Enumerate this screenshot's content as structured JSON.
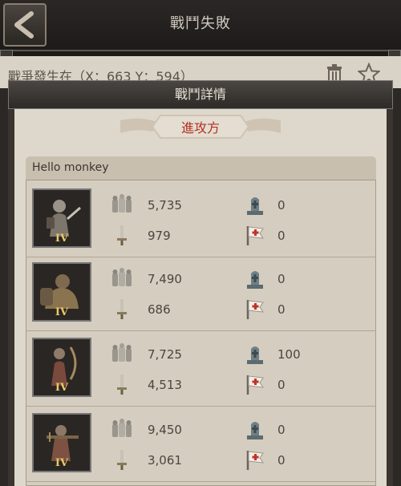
{
  "header": {
    "title": "戰鬥失敗"
  },
  "location": {
    "text": "戰爭發生在（X：663 Y：594）"
  },
  "dialog": {
    "title": "戰鬥詳情",
    "side_label": "進攻方"
  },
  "player": {
    "name": "Hello monkey"
  },
  "troops": [
    {
      "rank": "IV",
      "count": "5,735",
      "attack": "979",
      "dead": "0",
      "wounded": "0"
    },
    {
      "rank": "IV",
      "count": "7,490",
      "attack": "686",
      "dead": "0",
      "wounded": "0"
    },
    {
      "rank": "IV",
      "count": "7,725",
      "attack": "4,513",
      "dead": "100",
      "wounded": "0"
    },
    {
      "rank": "IV",
      "count": "9,450",
      "attack": "3,061",
      "dead": "0",
      "wounded": "0"
    }
  ],
  "colors": {
    "side_label": "#b23224",
    "rank": "#e8c86a"
  }
}
